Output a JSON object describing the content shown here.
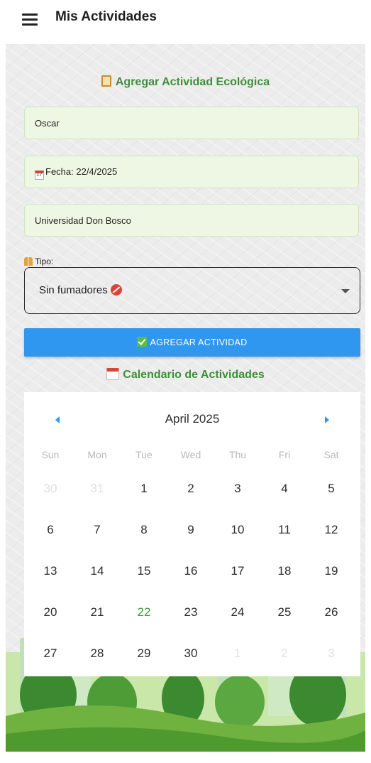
{
  "appbar": {
    "title": "Mis Actividades"
  },
  "form": {
    "title": "Agregar Actividad Ecológica",
    "name_value": "Oscar",
    "date_label": "Fecha: 22/4/2025",
    "place_value": "Universidad Don Bosco",
    "tipo_label": "Tipo:",
    "tipo_value": "Sin fumadores",
    "submit_label": "AGREGAR ACTIVIDAD"
  },
  "calendar": {
    "title": "Calendario de Actividades",
    "month": "April 2025",
    "weekdays": [
      "Sun",
      "Mon",
      "Tue",
      "Wed",
      "Thu",
      "Fri",
      "Sat"
    ],
    "weeks": [
      [
        "30",
        "31",
        "1",
        "2",
        "3",
        "4",
        "5"
      ],
      [
        "6",
        "7",
        "8",
        "9",
        "10",
        "11",
        "12"
      ],
      [
        "13",
        "14",
        "15",
        "16",
        "17",
        "18",
        "19"
      ],
      [
        "20",
        "21",
        "22",
        "23",
        "24",
        "25",
        "26"
      ],
      [
        "27",
        "28",
        "29",
        "30",
        "1",
        "2",
        "3"
      ]
    ],
    "selected_day": "22"
  },
  "colors": {
    "accent_green": "#3f8f3a",
    "button_blue": "#2f97f0",
    "field_bg": "#eef7e4"
  }
}
